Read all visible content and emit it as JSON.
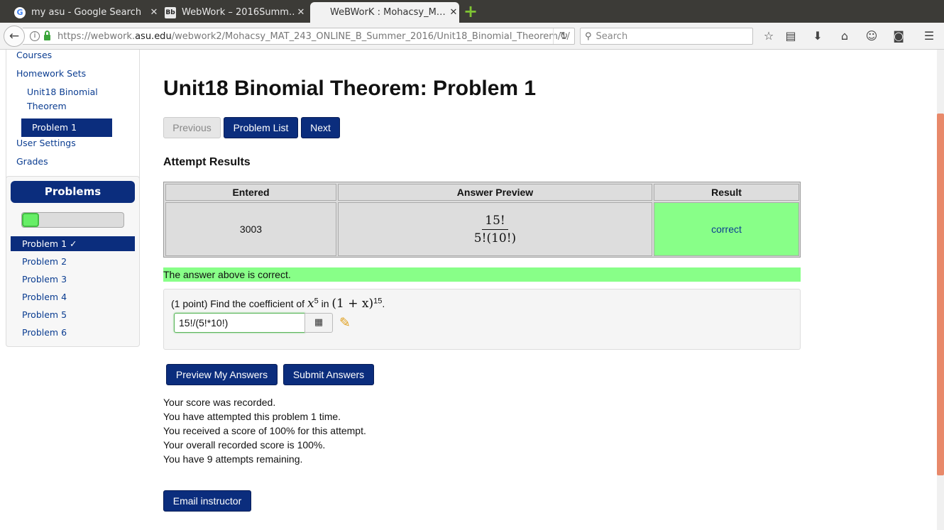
{
  "browser": {
    "tabs": [
      {
        "title": "my asu - Google Search",
        "favicon": "G"
      },
      {
        "title": "WebWork – 2016Summ…",
        "favicon": "Bb"
      },
      {
        "title": "WeBWorK : Mohacsy_M…",
        "favicon": ""
      }
    ],
    "url_prefix": "https://webwork.",
    "url_domain": "asu.edu",
    "url_path": "/webwork2/Mohacsy_MAT_243_ONLINE_B_Summer_2016/Unit18_Binomial_Theorem/1/",
    "search_placeholder": "Search"
  },
  "sidebar": {
    "courses": "Courses",
    "homework_sets": "Homework Sets",
    "set_name_line1": "Unit18 Binomial",
    "set_name_line2": "Theorem",
    "current_problem": "Problem 1",
    "user_settings": "User Settings",
    "grades": "Grades"
  },
  "problems_panel": {
    "header": "Problems",
    "progress_fraction": 0.1667,
    "items": [
      {
        "label": "Problem 1 ✓"
      },
      {
        "label": "Problem 2"
      },
      {
        "label": "Problem 3"
      },
      {
        "label": "Problem 4"
      },
      {
        "label": "Problem 5"
      },
      {
        "label": "Problem 6"
      }
    ]
  },
  "main": {
    "title": "Unit18 Binomial Theorem: Problem 1",
    "buttons": {
      "previous": "Previous",
      "problem_list": "Problem List",
      "next": "Next"
    },
    "attempt_results_heading": "Attempt Results",
    "results_table": {
      "headers": [
        "Entered",
        "Answer Preview",
        "Result"
      ],
      "entered": "3003",
      "preview_numerator": "15!",
      "preview_denominator": "5!(10!)",
      "result": "correct"
    },
    "correct_message": "The answer above is correct.",
    "problem": {
      "points": "(1 point) Find the coefficient of",
      "var": "x",
      "exp": "5",
      "in_word": "in",
      "expr": "(1 + x)",
      "expr_exp": "15",
      "period": ".",
      "answer_value": "15!/(5!*10!)"
    },
    "action_buttons": {
      "preview": "Preview My Answers",
      "submit": "Submit Answers"
    },
    "status_lines": [
      "Your score was recorded.",
      "You have attempted this problem 1 time.",
      "You received a score of 100% for this attempt.",
      "Your overall recorded score is 100%.",
      "You have 9 attempts remaining."
    ],
    "email_button": "Email instructor"
  },
  "colors": {
    "brand": "#0b2d7d",
    "correct_bg": "#88ff88",
    "scrollbar_thumb": "#e8896a"
  }
}
